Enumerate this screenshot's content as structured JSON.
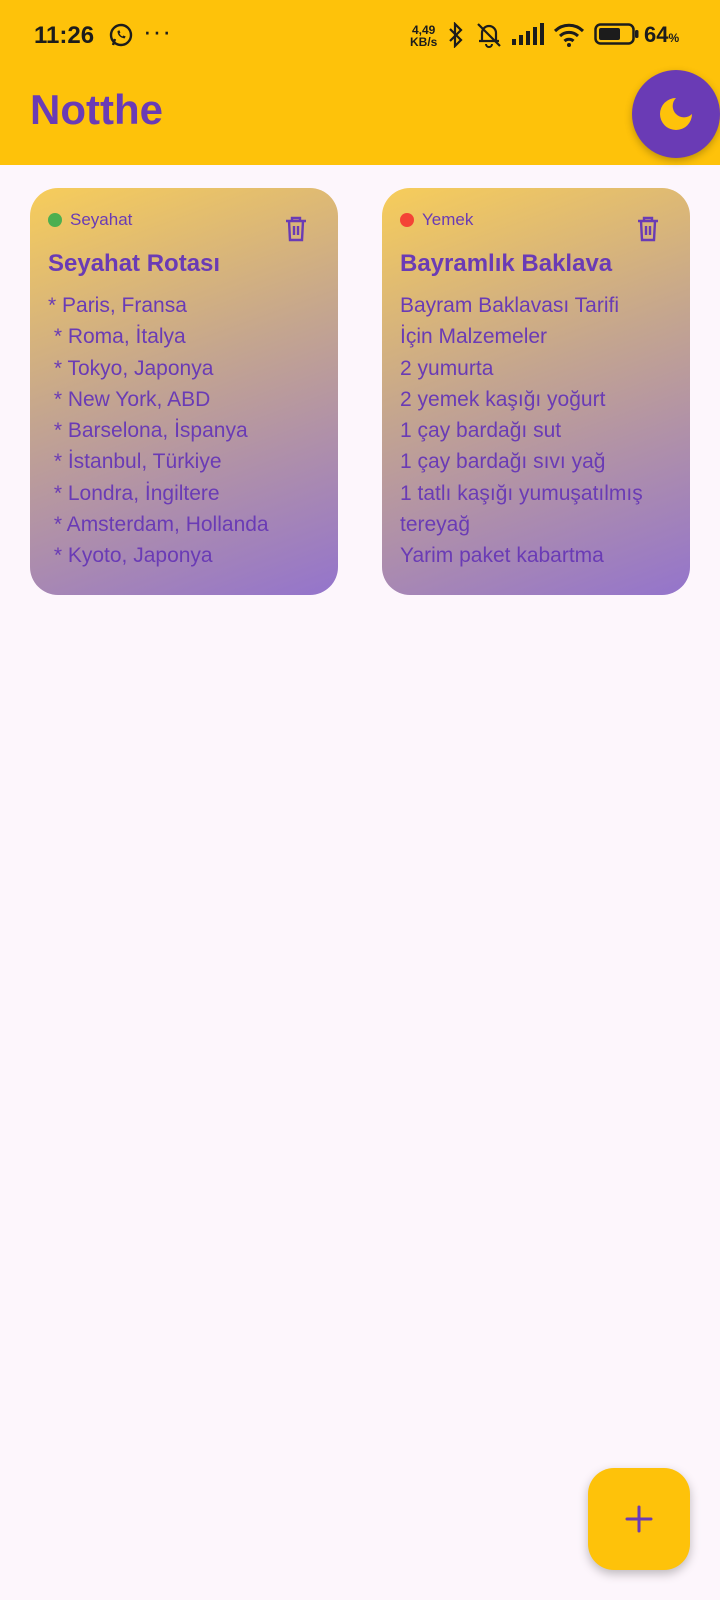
{
  "status_bar": {
    "time": "11:26",
    "more": "···",
    "speed_value": "4,49",
    "speed_unit": "KB/s",
    "battery_pct": "64",
    "battery_sym": "%",
    "icons": [
      "whatsapp-icon",
      "bluetooth-icon",
      "mute-icon",
      "signal-icon",
      "wifi-icon",
      "battery-icon"
    ]
  },
  "header": {
    "title": "Notthe",
    "theme_button_icon": "moon-icon",
    "bg_color": "#fec20a",
    "accent_color": "#6a3bb5"
  },
  "notes": [
    {
      "category": "Seyahat",
      "category_color": "#4caf50",
      "title": "Seyahat Rotası",
      "lines": [
        "* Paris, Fransa",
        " * Roma, İtalya",
        " * Tokyo, Japonya",
        " * New York, ABD",
        " * Barselona, İspanya",
        " * İstanbul, Türkiye",
        " * Londra, İngiltere",
        " * Amsterdam, Hollanda",
        " * Kyoto, Japonya"
      ]
    },
    {
      "category": "Yemek",
      "category_color": "#f44336",
      "title": "Bayramlık Baklava",
      "lines": [
        "Bayram Baklavası Tarifi",
        "İçin Malzemeler",
        "2 yumurta",
        "2 yemek kaşığı yoğurt",
        "1 çay bardağı sut",
        "1 çay bardağı sıvı yağ",
        "1 tatlı kaşığı yumuşatılmış",
        "tereyağ",
        "Yarim paket kabartma"
      ]
    }
  ],
  "fab": {
    "icon": "plus-icon"
  }
}
